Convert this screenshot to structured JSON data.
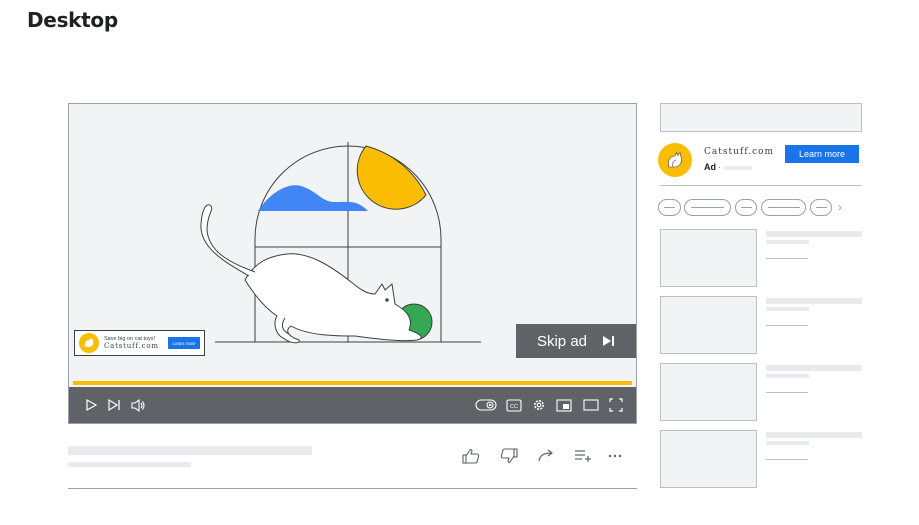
{
  "page": {
    "title": "Desktop"
  },
  "player": {
    "overlay_ad": {
      "headline": "Save big on cat toys!",
      "domain": "Catstuff.com",
      "cta": "Learn more"
    },
    "skip_ad": {
      "label": "Skip ad",
      "icon": "skip-next-icon"
    },
    "progress_color": "#fbbc04",
    "controls": [
      "play-icon",
      "next-icon",
      "volume-icon",
      "autoplay-toggle-icon",
      "captions-icon",
      "settings-icon",
      "miniplayer-icon",
      "theater-icon",
      "fullscreen-icon"
    ],
    "captions_label": "CC"
  },
  "actions": [
    "like-icon",
    "dislike-icon",
    "share-icon",
    "save-to-playlist-icon",
    "more-icon"
  ],
  "sidebar": {
    "ad": {
      "domain": "Catstuff.com",
      "badge": "Ad",
      "separator": "·",
      "cta": "Learn more",
      "accent": "#1a73e8",
      "logo_color": "#fbbc04"
    },
    "chips_next": "›",
    "recommendations_count": 4
  }
}
